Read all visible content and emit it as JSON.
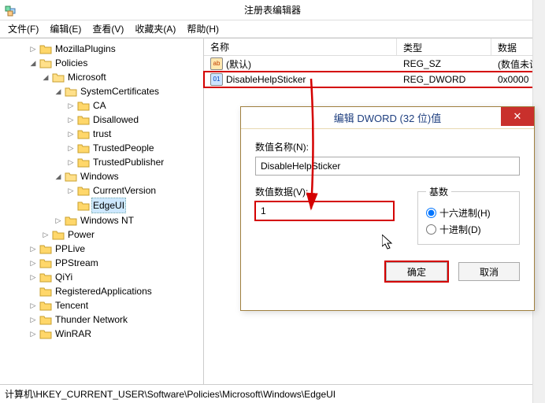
{
  "window": {
    "title": "注册表编辑器",
    "minimize": "−"
  },
  "menu": {
    "file": "文件(F)",
    "edit": "编辑(E)",
    "view": "查看(V)",
    "fav": "收藏夹(A)",
    "help": "帮助(H)"
  },
  "tree": {
    "items": [
      {
        "label": "MozillaPlugins",
        "depth": 2,
        "expander": "▷"
      },
      {
        "label": "Policies",
        "depth": 2,
        "expander": "◢"
      },
      {
        "label": "Microsoft",
        "depth": 3,
        "expander": "◢"
      },
      {
        "label": "SystemCertificates",
        "depth": 4,
        "expander": "◢"
      },
      {
        "label": "CA",
        "depth": 5,
        "expander": "▷"
      },
      {
        "label": "Disallowed",
        "depth": 5,
        "expander": "▷"
      },
      {
        "label": "trust",
        "depth": 5,
        "expander": "▷"
      },
      {
        "label": "TrustedPeople",
        "depth": 5,
        "expander": "▷"
      },
      {
        "label": "TrustedPublisher",
        "depth": 5,
        "expander": "▷"
      },
      {
        "label": "Windows",
        "depth": 4,
        "expander": "◢"
      },
      {
        "label": "CurrentVersion",
        "depth": 5,
        "expander": "▷"
      },
      {
        "label": "EdgeUI",
        "depth": 5,
        "expander": "",
        "selected": true
      },
      {
        "label": "Windows NT",
        "depth": 4,
        "expander": "▷"
      },
      {
        "label": "Power",
        "depth": 3,
        "expander": "▷"
      },
      {
        "label": "PPLive",
        "depth": 2,
        "expander": "▷"
      },
      {
        "label": "PPStream",
        "depth": 2,
        "expander": "▷"
      },
      {
        "label": "QiYi",
        "depth": 2,
        "expander": "▷"
      },
      {
        "label": "RegisteredApplications",
        "depth": 2,
        "expander": ""
      },
      {
        "label": "Tencent",
        "depth": 2,
        "expander": "▷"
      },
      {
        "label": "Thunder Network",
        "depth": 2,
        "expander": "▷"
      },
      {
        "label": "WinRAR",
        "depth": 2,
        "expander": "▷"
      }
    ]
  },
  "list": {
    "headers": {
      "name": "名称",
      "type": "类型",
      "data": "数据"
    },
    "rows": [
      {
        "icon": "str",
        "iconText": "ab",
        "name": "(默认)",
        "type": "REG_SZ",
        "data": "(数值未设"
      },
      {
        "icon": "bin",
        "iconText": "01",
        "name": "DisableHelpSticker",
        "type": "REG_DWORD",
        "data": "0x0000",
        "highlighted": true
      }
    ]
  },
  "dialog": {
    "title": "编辑 DWORD (32 位)值",
    "name_label": "数值名称(N):",
    "name_value": "DisableHelpSticker",
    "value_label": "数值数据(V):",
    "value_value": "1",
    "base_legend": "基数",
    "radio_hex": "十六进制(H)",
    "radio_dec": "十进制(D)",
    "ok": "确定",
    "cancel": "取消"
  },
  "statusbar": {
    "path": "计算机\\HKEY_CURRENT_USER\\Software\\Policies\\Microsoft\\Windows\\EdgeUI"
  },
  "annotation": {
    "arrow_color": "#d40000"
  }
}
